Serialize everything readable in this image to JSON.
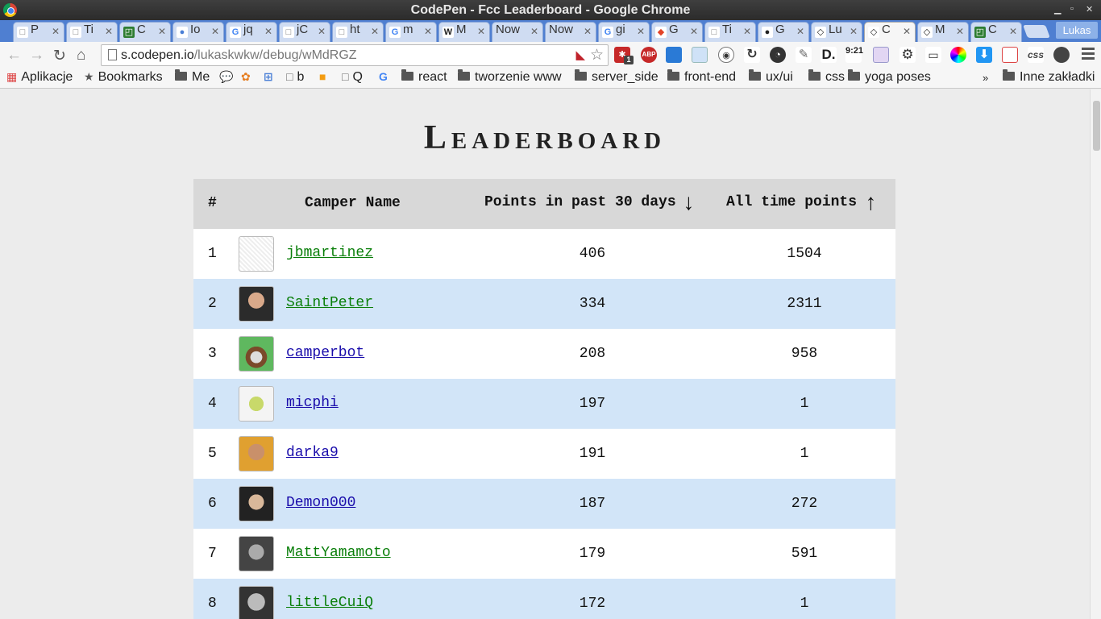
{
  "window": {
    "title": "CodePen - Fcc Leaderboard - Google Chrome"
  },
  "tabs": [
    {
      "label": "P",
      "icon": "page-icon"
    },
    {
      "label": "Ti",
      "icon": "page-icon"
    },
    {
      "label": "C",
      "icon": "codepen-green-icon"
    },
    {
      "label": "Io",
      "icon": "blue-dot-icon"
    },
    {
      "label": "jq",
      "icon": "google-icon"
    },
    {
      "label": "jC",
      "icon": "page-icon"
    },
    {
      "label": "ht",
      "icon": "page-icon"
    },
    {
      "label": "m",
      "icon": "google-icon"
    },
    {
      "label": "M",
      "icon": "wikipedia-icon"
    },
    {
      "label": "Now",
      "icon": "none"
    },
    {
      "label": "Now",
      "icon": "none"
    },
    {
      "label": "gi",
      "icon": "google-icon"
    },
    {
      "label": "G",
      "icon": "git-icon"
    },
    {
      "label": "Ti",
      "icon": "page-icon"
    },
    {
      "label": "G",
      "icon": "github-icon"
    },
    {
      "label": "Lu",
      "icon": "codepen-icon"
    },
    {
      "label": "C",
      "icon": "codepen-icon",
      "active": true
    },
    {
      "label": "M",
      "icon": "codepen-icon"
    },
    {
      "label": "C",
      "icon": "codepen-green-icon"
    }
  ],
  "user_button": "Lukas",
  "address": {
    "host": "s.codepen.io",
    "path": "/lukaskwkw/debug/wMdRGZ"
  },
  "bookmarks": [
    {
      "label": "Aplikacje",
      "type": "apps-icon"
    },
    {
      "label": "Bookmarks",
      "type": "star-icon"
    },
    {
      "label": "Me",
      "type": "folder-icon"
    },
    {
      "label": "",
      "type": "chat-icon"
    },
    {
      "label": "",
      "type": "pinwheel-icon"
    },
    {
      "label": "",
      "type": "translate-icon"
    },
    {
      "label": "b",
      "type": "page-icon"
    },
    {
      "label": "",
      "type": "orange-icon"
    },
    {
      "label": "Q",
      "type": "page-icon"
    },
    {
      "label": "",
      "type": "google-icon"
    },
    {
      "label": "react",
      "type": "folder-icon"
    },
    {
      "label": "tworzenie www",
      "type": "folder-icon"
    },
    {
      "label": "server_side",
      "type": "folder-icon"
    },
    {
      "label": "front-end",
      "type": "folder-icon"
    },
    {
      "label": "ux/ui",
      "type": "folder-icon"
    },
    {
      "label": "css",
      "type": "folder-icon"
    },
    {
      "label": "yoga poses",
      "type": "folder-icon"
    }
  ],
  "bookmarks_overflow": "»",
  "other_bookmarks": "Inne zakładki",
  "extension_badge": "1",
  "extension_clock": "9:21",
  "extension_css": "css",
  "page": {
    "heading_first": "L",
    "heading_rest": "EADERBOARD",
    "columns": {
      "rank": "#",
      "name": "Camper Name",
      "recent": "Points in past 30 days",
      "alltime": "All time points"
    },
    "sort_recent_arrow": "↓",
    "sort_alltime_arrow": "↑",
    "rows": [
      {
        "rank": "1",
        "name": "jbmartinez",
        "recent": "406",
        "alltime": "1504",
        "link_color": "#0a7f0a"
      },
      {
        "rank": "2",
        "name": "SaintPeter",
        "recent": "334",
        "alltime": "2311",
        "link_color": "#0a7f0a"
      },
      {
        "rank": "3",
        "name": "camperbot",
        "recent": "208",
        "alltime": "958",
        "link_color": "#1a0dab"
      },
      {
        "rank": "4",
        "name": "micphi",
        "recent": "197",
        "alltime": "1",
        "link_color": "#1a0dab"
      },
      {
        "rank": "5",
        "name": "darka9",
        "recent": "191",
        "alltime": "1",
        "link_color": "#1a0dab"
      },
      {
        "rank": "6",
        "name": "Demon000",
        "recent": "187",
        "alltime": "272",
        "link_color": "#1a0dab"
      },
      {
        "rank": "7",
        "name": "MattYamamoto",
        "recent": "179",
        "alltime": "591",
        "link_color": "#0a7f0a"
      },
      {
        "rank": "8",
        "name": "littleCuiQ",
        "recent": "172",
        "alltime": "1",
        "link_color": "#0a7f0a"
      }
    ]
  }
}
